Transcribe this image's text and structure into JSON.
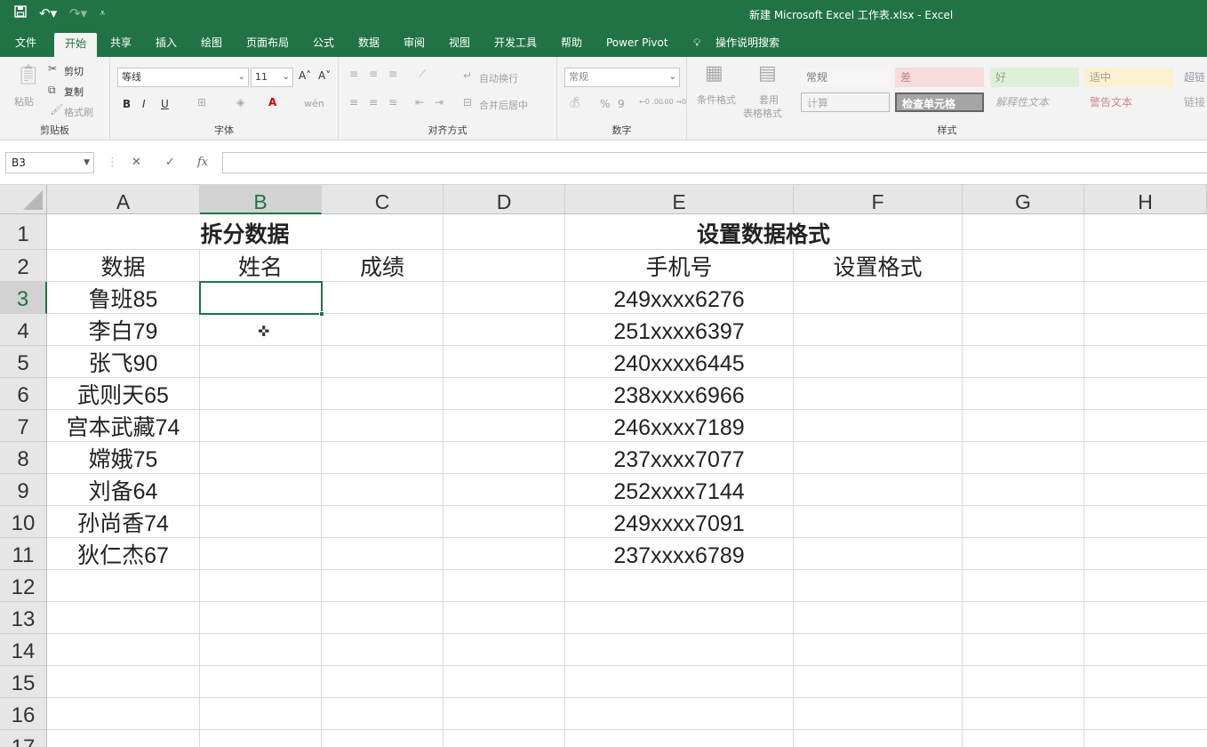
{
  "window": {
    "title": "新建 Microsoft Excel 工作表.xlsx  -  Excel",
    "qat": {
      "save_icon": "save-icon",
      "undo_icon": "undo-icon",
      "redo_icon": "redo-icon",
      "customize_icon": "chevron-down-icon"
    }
  },
  "menu": {
    "tabs": [
      "文件",
      "开始",
      "共享",
      "插入",
      "绘图",
      "页面布局",
      "公式",
      "数据",
      "审阅",
      "视图",
      "开发工具",
      "帮助",
      "Power Pivot",
      "操作说明搜索"
    ],
    "active_tab": "开始"
  },
  "ribbon": {
    "clipboard": {
      "label": "剪贴板",
      "paste": "粘贴",
      "cut": "剪切",
      "copy": "复制",
      "format_painter": "格式刷"
    },
    "font": {
      "label": "字体",
      "font_name": "等线",
      "font_size": "11",
      "bold": "B",
      "italic": "I",
      "underline": "U",
      "grow": "A˄",
      "shrink": "A˅",
      "wen": "wén"
    },
    "alignment": {
      "label": "对齐方式",
      "wrap_text": "自动换行",
      "merge_center": "合并后居中"
    },
    "number": {
      "label": "数字",
      "format": "常规",
      "percent": "%",
      "comma": "9",
      "inc_decimal": "←0 .00",
      "dec_decimal": ".00 →0"
    },
    "styles": {
      "label": "样式",
      "conditional_format": "条件格式",
      "table_format_1": "套用",
      "table_format_2": "表格格式",
      "cells": [
        "常规",
        "差",
        "好",
        "适中",
        "超链",
        "计算",
        "检查单元格",
        "解释性文本",
        "警告文本",
        "链接"
      ]
    }
  },
  "formula_bar": {
    "name_box": "B3",
    "cancel": "✕",
    "enter": "✓",
    "fx": "fx",
    "value": ""
  },
  "sheet": {
    "columns": [
      "A",
      "B",
      "C",
      "D",
      "E",
      "F",
      "G",
      "H"
    ],
    "selected_column": "B",
    "rows": [
      "1",
      "2",
      "3",
      "4",
      "5",
      "6",
      "7",
      "8",
      "9",
      "10",
      "11",
      "12",
      "13",
      "14",
      "15",
      "16",
      "17"
    ],
    "selected_row": "3",
    "headers": {
      "split_title": "拆分数据",
      "format_title": "设置数据格式"
    },
    "row2": {
      "a": "数据",
      "b": "姓名",
      "c": "成绩",
      "e": "手机号",
      "f": "设置格式"
    },
    "data_col_a": [
      "鲁班85",
      "李白79",
      "张飞90",
      "武则天65",
      "宫本武藏74",
      "嫦娥75",
      "刘备64",
      "孙尚香74",
      "狄仁杰67"
    ],
    "data_col_e": [
      "249xxxx6276",
      "251xxxx6397",
      "240xxxx6445",
      "238xxxx6966",
      "246xxxx7189",
      "237xxxx7077",
      "252xxxx7144",
      "249xxxx7091",
      "237xxxx6789"
    ]
  }
}
